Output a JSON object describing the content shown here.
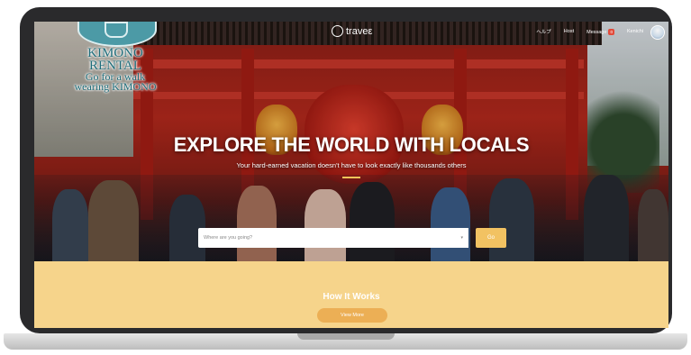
{
  "nav": {
    "brand": "traveε",
    "help": "ヘルプ",
    "host": "Host",
    "message": "Message",
    "message_count": "0",
    "user": "Kenichi"
  },
  "logo": {
    "line1": "KIMONO",
    "line2": "RENTAL",
    "line3": "Go for a walk",
    "line4": "wearing KIMONO"
  },
  "hero": {
    "headline": "EXPLORE THE WORLD WITH LOCALS",
    "subline": "Your hard-earned vacation doesn't have to look exactly like thousands others"
  },
  "search": {
    "placeholder": "Where are you going?",
    "go_label": "Go"
  },
  "how_it_works": {
    "title": "How It Works",
    "button_label": "View More"
  },
  "colors": {
    "accent": "#f2c262",
    "section_bg": "#f6d48b",
    "bezel": "#2a2a2c",
    "temple_red": "#b2281c"
  }
}
